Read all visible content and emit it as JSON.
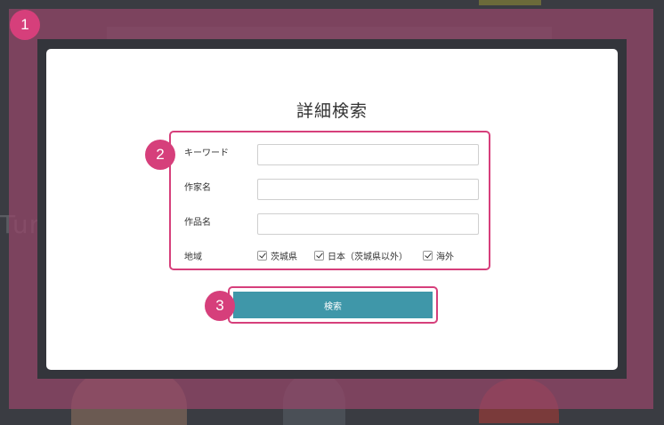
{
  "colors": {
    "highlight": "#d63f7b",
    "button": "#3f97a9",
    "overlay": "#96466a"
  },
  "background": {
    "text": "Turi"
  },
  "modal": {
    "title": "詳細検索",
    "fields": {
      "keyword_label": "キーワード",
      "artist_label": "作家名",
      "work_label": "作品名",
      "region_label": "地域"
    },
    "region_options": [
      {
        "label": "茨城県",
        "checked": true
      },
      {
        "label": "日本（茨城県以外）",
        "checked": true
      },
      {
        "label": "海外",
        "checked": true
      }
    ],
    "search_button": "検索"
  },
  "annotations": {
    "badge1": "1",
    "badge2": "2",
    "badge3": "3"
  }
}
